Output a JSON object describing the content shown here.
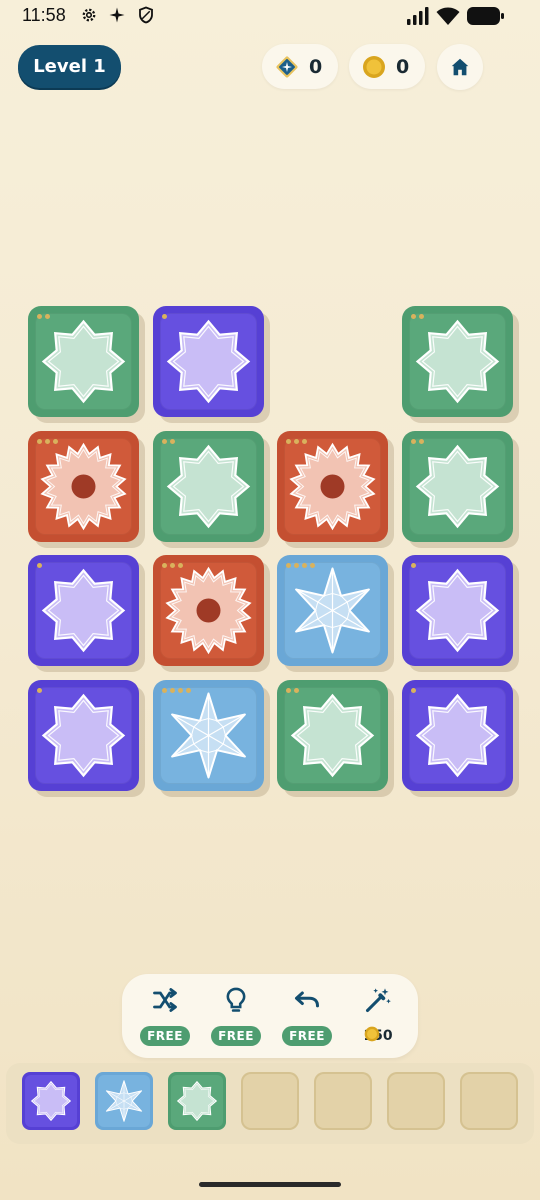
{
  "status_bar": {
    "time": "11:58"
  },
  "header": {
    "level_label": "Level 1",
    "gems": "0",
    "coins": "0"
  },
  "board": {
    "tiles": [
      {
        "row": 0,
        "col": 0,
        "color": "green",
        "motif": "octagram",
        "dots": 2
      },
      {
        "row": 0,
        "col": 1,
        "color": "purple",
        "motif": "octagram",
        "dots": 1
      },
      {
        "row": 0,
        "col": 3,
        "color": "green",
        "motif": "octagram",
        "dots": 2
      },
      {
        "row": 1,
        "col": 0,
        "color": "red",
        "motif": "sunburst",
        "dots": 3
      },
      {
        "row": 1,
        "col": 1,
        "color": "green",
        "motif": "octagram",
        "dots": 2
      },
      {
        "row": 1,
        "col": 2,
        "color": "red",
        "motif": "sunburst",
        "dots": 3
      },
      {
        "row": 1,
        "col": 3,
        "color": "green",
        "motif": "octagram",
        "dots": 2
      },
      {
        "row": 2,
        "col": 0,
        "color": "purple",
        "motif": "octagram",
        "dots": 1
      },
      {
        "row": 2,
        "col": 1,
        "color": "red",
        "motif": "sunburst",
        "dots": 3
      },
      {
        "row": 2,
        "col": 2,
        "color": "blue",
        "motif": "hexastar",
        "dots": 4
      },
      {
        "row": 2,
        "col": 3,
        "color": "purple",
        "motif": "octagram",
        "dots": 1
      },
      {
        "row": 3,
        "col": 0,
        "color": "purple",
        "motif": "octagram",
        "dots": 1
      },
      {
        "row": 3,
        "col": 1,
        "color": "blue",
        "motif": "hexastar",
        "dots": 4
      },
      {
        "row": 3,
        "col": 2,
        "color": "green",
        "motif": "octagram",
        "dots": 2
      },
      {
        "row": 3,
        "col": 3,
        "color": "purple",
        "motif": "octagram",
        "dots": 1
      }
    ]
  },
  "tools": {
    "shuffle": {
      "badge": "FREE"
    },
    "hint": {
      "badge": "FREE"
    },
    "undo": {
      "badge": "FREE"
    },
    "magic": {
      "price": "150"
    }
  },
  "tray": {
    "slots": [
      {
        "color": "purple",
        "motif": "octagram"
      },
      {
        "color": "blue",
        "motif": "hexastar"
      },
      {
        "color": "green",
        "motif": "octagram"
      },
      null,
      null,
      null,
      null
    ]
  },
  "colors": {
    "green": "#4e9d70",
    "purple": "#5640d4",
    "red": "#c44f31",
    "blue": "#6aa7d6",
    "header_pill": "#134e6f",
    "badge": "#4e9d70"
  }
}
